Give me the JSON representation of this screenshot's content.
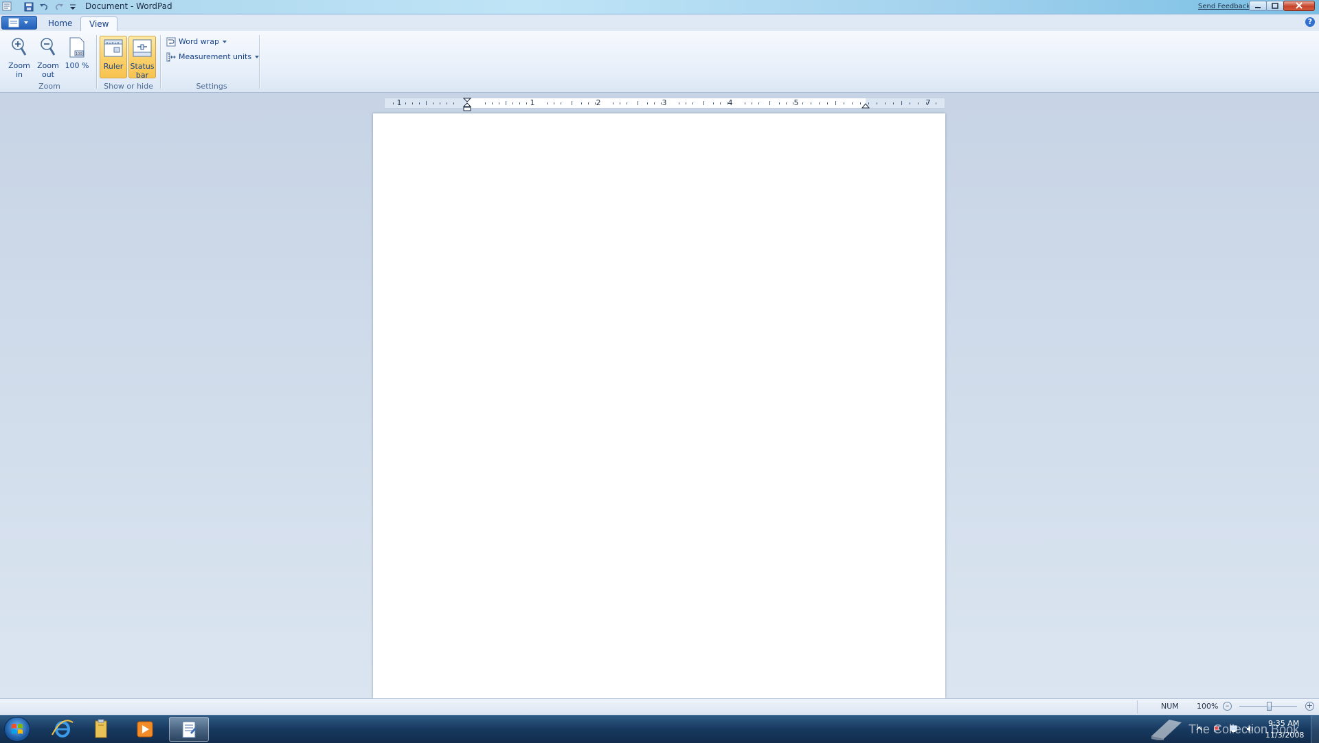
{
  "window": {
    "title": "Document - WordPad",
    "send_feedback": "Send Feedback"
  },
  "tabs": [
    {
      "label": "Home",
      "active": false
    },
    {
      "label": "View",
      "active": true
    }
  ],
  "ribbon": {
    "zoom_group": {
      "label": "Zoom",
      "zoom_in": "Zoom in",
      "zoom_out": "Zoom out",
      "hundred": "100 %"
    },
    "show_hide_group": {
      "label": "Show or hide",
      "ruler": "Ruler",
      "status_bar": "Status bar"
    },
    "settings_group": {
      "label": "Settings",
      "word_wrap": "Word wrap",
      "measurement_units": "Measurement units"
    }
  },
  "ruler": {
    "numbers": [
      "1",
      "1",
      "2",
      "3",
      "4",
      "5",
      "7"
    ]
  },
  "statusbar": {
    "num": "NUM",
    "zoom": "100%",
    "zoom_level": 1.0
  },
  "taskbar": {
    "watermark": "The Collection Book",
    "time": "9:35 AM",
    "date": "11/3/2008"
  },
  "colors": {
    "accent": "#15428b",
    "active_button": "#fbd26e",
    "taskbar": "#17395f"
  }
}
